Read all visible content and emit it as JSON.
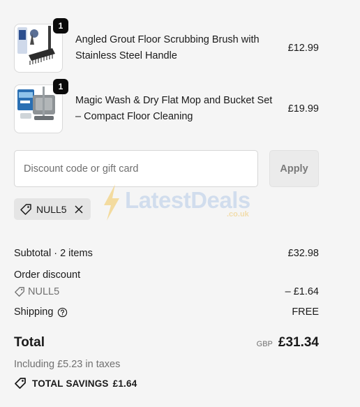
{
  "items": [
    {
      "title": "Angled Grout Floor Scrubbing Brush with Stainless Steel Handle",
      "price": "£12.99",
      "quantity": "1",
      "image_icon": "scrub-brush-product-image"
    },
    {
      "title": "Magic Wash & Dry Flat Mop and Bucket Set – Compact Floor Cleaning",
      "price": "£19.99",
      "quantity": "1",
      "image_icon": "mop-bucket-product-image"
    }
  ],
  "discount": {
    "placeholder": "Discount code or gift card",
    "value": "",
    "apply_label": "Apply",
    "applied_code": "NULL5"
  },
  "watermark": {
    "brand": "LatestDeals",
    "sub": ".co.uk"
  },
  "summary": {
    "subtotal_label": "Subtotal · 2 items",
    "subtotal_value": "£32.98",
    "order_discount_label": "Order discount",
    "discount_code": "NULL5",
    "discount_value": "– £1.64",
    "shipping_label": "Shipping",
    "shipping_value": "FREE",
    "total_label": "Total",
    "currency": "GBP",
    "total_value": "£31.34",
    "taxes_text": "Including £5.23 in taxes",
    "savings_label": "TOTAL SAVINGS",
    "savings_value": "£1.64"
  },
  "colors": {
    "background": "#f5f5f5",
    "text": "#1a1a1a",
    "muted": "#707070",
    "badge": "#0b0b0b"
  }
}
